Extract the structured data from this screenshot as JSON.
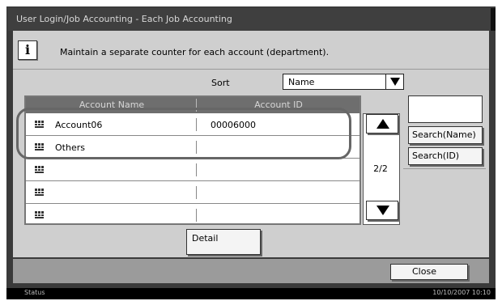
{
  "window": {
    "title": "User Login/Job Accounting - Each Job Accounting"
  },
  "info": {
    "icon": "info-icon",
    "message": "Maintain a separate counter for each account (department)."
  },
  "sort": {
    "label": "Sort",
    "selected": "Name"
  },
  "table": {
    "columns": [
      "Account Name",
      "Account ID"
    ],
    "rows": [
      {
        "name": "Account06",
        "id": "00006000"
      },
      {
        "name": "Others",
        "id": ""
      },
      {
        "name": "",
        "id": ""
      },
      {
        "name": "",
        "id": ""
      },
      {
        "name": "",
        "id": ""
      }
    ],
    "row_icon": "account-group-icon"
  },
  "pagination": {
    "page": "2/2",
    "up_icon": "triangle-up-icon",
    "down_icon": "triangle-down-icon"
  },
  "search": {
    "input_value": "",
    "by_name_label": "Search(Name)",
    "by_id_label": "Search(ID)"
  },
  "actions": {
    "detail_label": "Detail",
    "close_label": "Close"
  },
  "status_bar": {
    "label": "Status",
    "datetime": "10/10/2007   10:10"
  },
  "colors": {
    "title_bar": "#3f3f3f",
    "panel": "#cfcfcf",
    "table_header": "#6e6e6e",
    "bottom_bar": "#9b9b9b"
  }
}
